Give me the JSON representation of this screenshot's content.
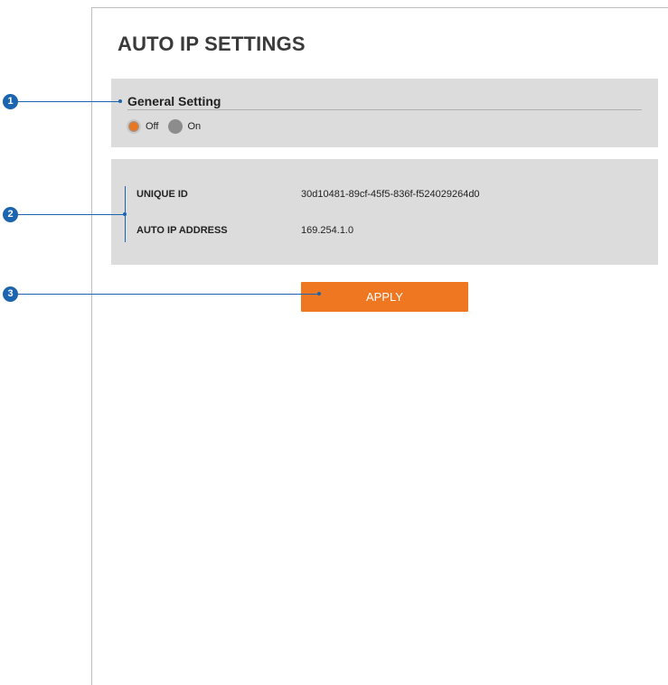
{
  "page": {
    "title": "AUTO IP SETTINGS"
  },
  "general": {
    "title": "General Setting",
    "options": [
      {
        "label": "Off",
        "selected": true
      },
      {
        "label": "On",
        "selected": false
      }
    ]
  },
  "info": {
    "unique_id_label": "UNIQUE ID",
    "unique_id_value": "30d10481-89cf-45f5-836f-f524029264d0",
    "auto_ip_label": "AUTO IP ADDRESS",
    "auto_ip_value": "169.254.1.0"
  },
  "actions": {
    "apply_label": "APPLY"
  },
  "callouts": [
    "1",
    "2",
    "3"
  ],
  "colors": {
    "accent": "#ef7722",
    "callout": "#1a64b0",
    "panel": "#dcdcdc"
  }
}
